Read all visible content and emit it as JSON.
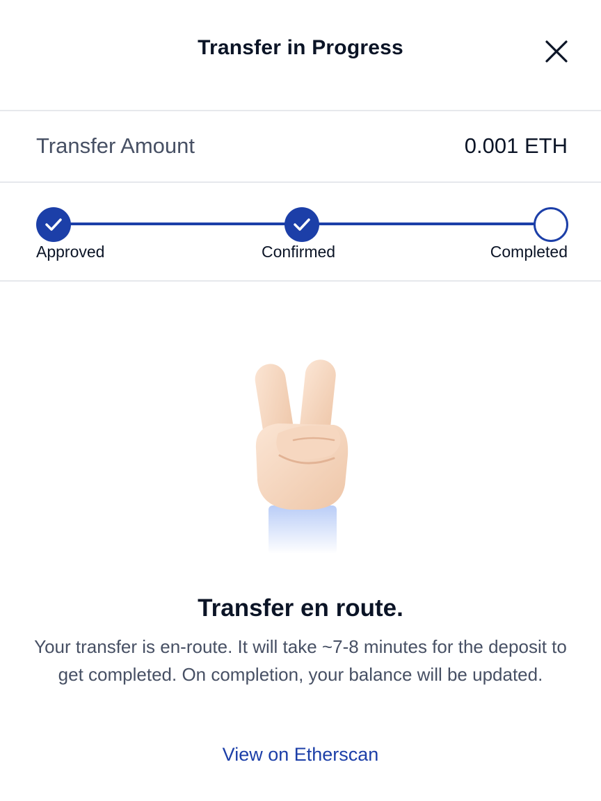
{
  "header": {
    "title": "Transfer in Progress",
    "close_icon": "close-icon"
  },
  "transfer": {
    "amount_label": "Transfer Amount",
    "amount_value": "0.001 ETH"
  },
  "steps": [
    {
      "label": "Approved",
      "status": "done"
    },
    {
      "label": "Confirmed",
      "status": "done"
    },
    {
      "label": "Completed",
      "status": "pending"
    }
  ],
  "illustration": {
    "icon": "peace-hand-icon"
  },
  "status": {
    "title": "Transfer en route.",
    "body": "Your transfer is en-route. It will take ~7-8 minutes for the deposit to get completed. On completion, your balance will be updated."
  },
  "link": {
    "label": "View on Etherscan"
  },
  "colors": {
    "accent": "#1c3fa8",
    "text_primary": "#0b1426",
    "text_secondary": "#475064",
    "divider": "#e6e8ec"
  }
}
